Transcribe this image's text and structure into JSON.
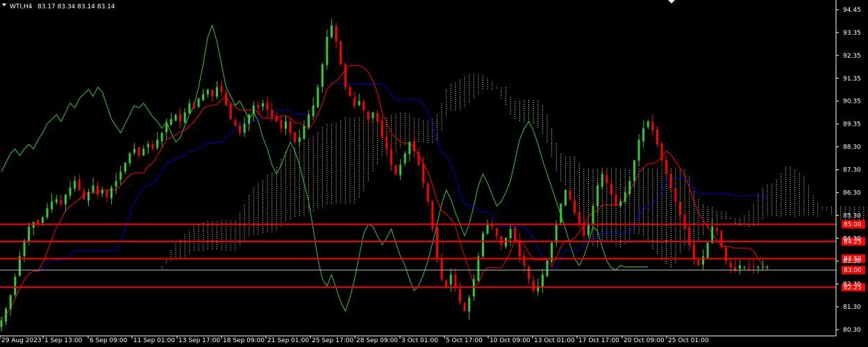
{
  "header": {
    "symbol_timeframe": "WTI,H4",
    "ohlc": "83.17 83.34 83.14 83.14",
    "menu_arrow_icon": "triangle-down-icon"
  },
  "colors": {
    "background": "#000000",
    "axis": "#ffffff",
    "bull": "#33cc33",
    "bear": "#ff0000",
    "tenkan": "#ff0000",
    "kijun": "#0000cc",
    "chikou": "#33cc33",
    "cloud_up": "#ffe4c4",
    "cloud_down": "#ffffff",
    "level_line": "#ff0000",
    "level_label_bg": "#ff0000",
    "current_price_bg": "#c0c0c0"
  },
  "chart_data": {
    "type": "candlestick",
    "title": "",
    "ylim": [
      80.3,
      94.45
    ],
    "y_ticks": [
      "94.45",
      "93.35",
      "92.35",
      "91.35",
      "90.35",
      "89.35",
      "88.30",
      "87.30",
      "86.30",
      "85.30",
      "84.30",
      "83.30",
      "82.30",
      "81.30",
      "80.30"
    ],
    "x_ticks": [
      "29 Aug 2023",
      "1 Sep 13:00",
      "6 Sep 09:00",
      "11 Sep 01:00",
      "13 Sep 17:00",
      "18 Sep 09:00",
      "21 Sep 01:00",
      "25 Sep 17:00",
      "28 Sep 09:00",
      "3 Oct 01:00",
      "5 Oct 17:00",
      "10 Oct 09:00",
      "13 Oct 01:00",
      "17 Oct 17:00",
      "20 Oct 09:00",
      "25 Oct 01:00"
    ],
    "grid": false,
    "price_levels": [
      {
        "label": "85.00",
        "value": 85.0
      },
      {
        "label": "84.25",
        "value": 84.25
      },
      {
        "label": "83.50",
        "value": 83.5
      },
      {
        "label": "82.25",
        "value": 82.25
      }
    ],
    "current_price": {
      "label": "83.00",
      "value": 83.0
    },
    "bar_count": 166,
    "close_series": [
      80.8,
      81.3,
      81.9,
      82.7,
      83.6,
      84.3,
      84.9,
      85.1,
      85.0,
      85.3,
      85.7,
      86.0,
      86.1,
      85.9,
      86.3,
      86.6,
      86.9,
      86.5,
      86.1,
      86.4,
      86.7,
      86.3,
      86.5,
      86.2,
      86.6,
      86.9,
      87.3,
      87.7,
      88.1,
      88.3,
      88.0,
      88.3,
      88.5,
      88.3,
      88.7,
      89.0,
      89.4,
      89.6,
      89.8,
      89.5,
      89.9,
      90.3,
      90.1,
      90.5,
      90.7,
      90.9,
      90.6,
      91.0,
      90.8,
      90.2,
      89.6,
      89.3,
      89.0,
      89.4,
      89.8,
      90.2,
      90.1,
      90.3,
      90.0,
      89.7,
      89.5,
      89.2,
      89.5,
      89.0,
      88.6,
      88.8,
      89.3,
      89.8,
      90.2,
      91.0,
      92.0,
      93.2,
      93.7,
      93.0,
      92.0,
      91.0,
      90.6,
      90.2,
      90.4,
      90.0,
      89.6,
      89.9,
      89.5,
      88.8,
      88.3,
      87.6,
      87.2,
      87.6,
      88.1,
      88.6,
      88.2,
      87.6,
      86.8,
      86.0,
      84.8,
      83.5,
      82.6,
      82.3,
      82.8,
      82.2,
      81.6,
      81.2,
      81.8,
      82.6,
      83.6,
      84.6,
      85.0,
      84.9,
      84.5,
      84.1,
      84.4,
      84.8,
      84.2,
      83.6,
      83.2,
      82.6,
      82.1,
      82.3,
      82.8,
      83.4,
      84.2,
      85.0,
      85.9,
      86.5,
      86.1,
      85.5,
      85.0,
      84.5,
      85.0,
      85.8,
      86.7,
      87.2,
      86.8,
      86.3,
      85.8,
      86.0,
      86.4,
      86.9,
      87.8,
      88.7,
      89.2,
      89.5,
      89.1,
      88.5,
      87.8,
      87.2,
      86.6,
      86.0,
      85.4,
      84.8,
      84.1,
      83.5,
      83.2,
      83.6,
      84.2,
      84.9,
      84.7,
      84.0,
      83.4,
      83.1,
      83.0,
      83.2,
      83.14,
      83.14,
      83.14,
      83.14,
      83.14,
      83.14
    ]
  }
}
